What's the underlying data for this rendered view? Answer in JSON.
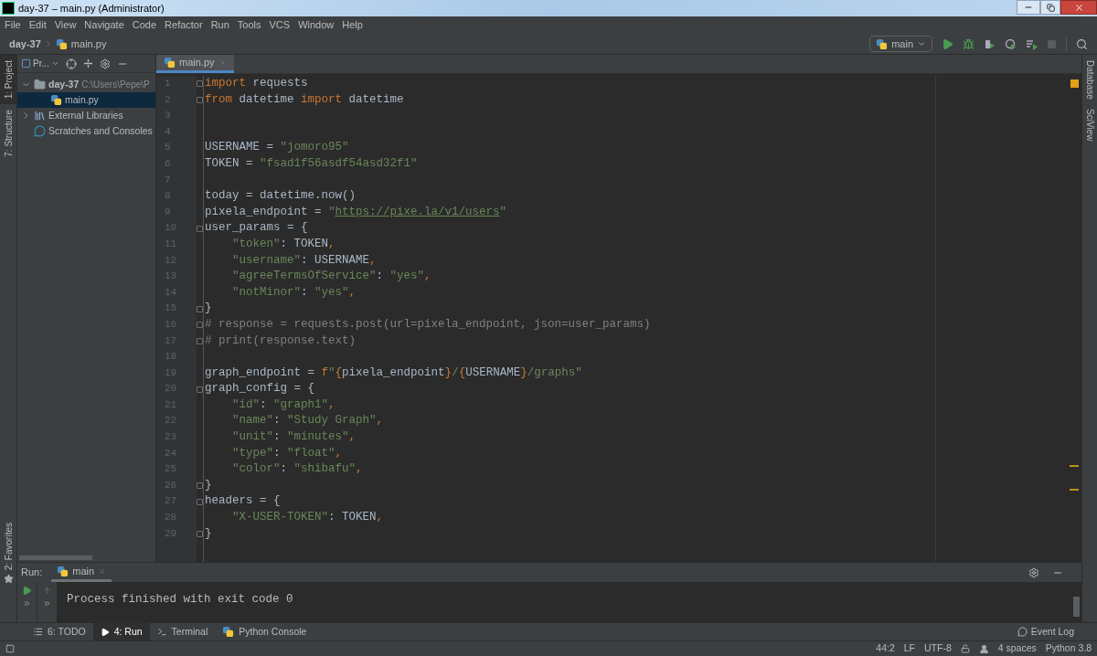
{
  "window": {
    "title": "day-37 – main.py (Administrator)"
  },
  "menu": [
    "File",
    "Edit",
    "View",
    "Navigate",
    "Code",
    "Refactor",
    "Run",
    "Tools",
    "VCS",
    "Window",
    "Help"
  ],
  "breadcrumb": [
    "day-37",
    "main.py"
  ],
  "run_config": {
    "label": "main"
  },
  "left_tool_tabs": [
    {
      "label": "1: Project",
      "selected": true
    },
    {
      "label": "7: Structure",
      "selected": false
    }
  ],
  "bottom_left_tool_tab": {
    "label": "2: Favorites"
  },
  "right_tool_tabs": [
    {
      "label": "Database"
    },
    {
      "label": "SciView"
    }
  ],
  "project": {
    "view_label": "Pr...",
    "tree": [
      {
        "label": "day-37",
        "kind": "folder",
        "path": "C:\\Users\\Pepe\\P",
        "expanded": true,
        "selected": false,
        "children": [
          {
            "label": "main.py",
            "kind": "python",
            "selected": true
          }
        ]
      },
      {
        "label": "External Libraries",
        "kind": "library",
        "expanded": false,
        "selected": false
      },
      {
        "label": "Scratches and Consoles",
        "kind": "scratch",
        "selected": false
      }
    ]
  },
  "editor": {
    "tabs": [
      {
        "label": "main.py",
        "selected": true
      }
    ],
    "lines": [
      {
        "number": "1",
        "fold": true,
        "tokens": [
          {
            "kind": "keyword",
            "text": "import"
          },
          {
            "kind": "plain",
            "text": " requests"
          }
        ]
      },
      {
        "number": "2",
        "fold": true,
        "tokens": [
          {
            "kind": "keyword",
            "text": "from"
          },
          {
            "kind": "plain",
            "text": " datetime "
          },
          {
            "kind": "keyword",
            "text": "import"
          },
          {
            "kind": "plain",
            "text": " datetime"
          }
        ]
      },
      {
        "number": "3",
        "fold": false
      },
      {
        "number": "4",
        "fold": false
      },
      {
        "number": "5",
        "fold": false,
        "tokens": [
          {
            "kind": "plain",
            "text": "USERNAME = "
          },
          {
            "kind": "string",
            "text": "\"jomoro95\""
          }
        ]
      },
      {
        "number": "6",
        "fold": false,
        "tokens": [
          {
            "kind": "plain",
            "text": "TOKEN = "
          },
          {
            "kind": "string",
            "text": "\"fsad1f56asdf54asd32f1\""
          }
        ]
      },
      {
        "number": "7",
        "fold": false
      },
      {
        "number": "8",
        "fold": false,
        "tokens": [
          {
            "kind": "plain",
            "text": "today = datetime.now()"
          }
        ]
      },
      {
        "number": "9",
        "fold": false,
        "tokens": [
          {
            "kind": "plain",
            "text": "pixela_endpoint = "
          },
          {
            "kind": "string",
            "text": "\""
          },
          {
            "kind": "link",
            "text": "https://pixe.la/v1/users"
          },
          {
            "kind": "string",
            "text": "\""
          }
        ]
      },
      {
        "number": "10",
        "fold": true,
        "tokens": [
          {
            "kind": "plain",
            "text": "user_params = {"
          }
        ]
      },
      {
        "number": "11",
        "fold": false,
        "indented": true,
        "tokens": [
          {
            "kind": "string",
            "text": "\"token\""
          },
          {
            "kind": "plain",
            "text": ": TOKEN"
          },
          {
            "kind": "punct",
            "text": ","
          }
        ]
      },
      {
        "number": "12",
        "fold": false,
        "indented": true,
        "tokens": [
          {
            "kind": "string",
            "text": "\"username\""
          },
          {
            "kind": "plain",
            "text": ": USERNAME"
          },
          {
            "kind": "punct",
            "text": ","
          }
        ]
      },
      {
        "number": "13",
        "fold": false,
        "indented": true,
        "tokens": [
          {
            "kind": "string",
            "text": "\"agreeTermsOfService\""
          },
          {
            "kind": "plain",
            "text": ": "
          },
          {
            "kind": "string",
            "text": "\"yes\""
          },
          {
            "kind": "punct",
            "text": ","
          }
        ]
      },
      {
        "number": "14",
        "fold": false,
        "indented": true,
        "tokens": [
          {
            "kind": "string",
            "text": "\"notMinor\""
          },
          {
            "kind": "plain",
            "text": ": "
          },
          {
            "kind": "string",
            "text": "\"yes\""
          },
          {
            "kind": "punct",
            "text": ","
          }
        ]
      },
      {
        "number": "15",
        "fold": true,
        "tokens": [
          {
            "kind": "plain",
            "text": "}"
          }
        ]
      },
      {
        "number": "16",
        "fold": true,
        "tokens": [
          {
            "kind": "comment",
            "text": "# response = requests.post(url=pixela_endpoint, json=user_params)"
          }
        ]
      },
      {
        "number": "17",
        "fold": true,
        "tokens": [
          {
            "kind": "comment",
            "text": "# print(response.text)"
          }
        ]
      },
      {
        "number": "18",
        "fold": false
      },
      {
        "number": "19",
        "fold": false,
        "tokens": [
          {
            "kind": "plain",
            "text": "graph_endpoint = "
          },
          {
            "kind": "keyword",
            "text": "f"
          },
          {
            "kind": "string",
            "text": "\""
          },
          {
            "kind": "punct",
            "text": "{"
          },
          {
            "kind": "plain",
            "text": "pixela_endpoint"
          },
          {
            "kind": "punct",
            "text": "}"
          },
          {
            "kind": "string",
            "text": "/"
          },
          {
            "kind": "punct",
            "text": "{"
          },
          {
            "kind": "plain",
            "text": "USERNAME"
          },
          {
            "kind": "punct",
            "text": "}"
          },
          {
            "kind": "string",
            "text": "/graphs\""
          }
        ]
      },
      {
        "number": "20",
        "fold": true,
        "tokens": [
          {
            "kind": "plain",
            "text": "graph_config = {"
          }
        ]
      },
      {
        "number": "21",
        "fold": false,
        "indented": true,
        "tokens": [
          {
            "kind": "string",
            "text": "\"id\""
          },
          {
            "kind": "plain",
            "text": ": "
          },
          {
            "kind": "string",
            "text": "\"graph1\""
          },
          {
            "kind": "punct",
            "text": ","
          }
        ]
      },
      {
        "number": "22",
        "fold": false,
        "indented": true,
        "tokens": [
          {
            "kind": "string",
            "text": "\"name\""
          },
          {
            "kind": "plain",
            "text": ": "
          },
          {
            "kind": "string",
            "text": "\"Study Graph\""
          },
          {
            "kind": "punct",
            "text": ","
          }
        ]
      },
      {
        "number": "23",
        "fold": false,
        "indented": true,
        "tokens": [
          {
            "kind": "string",
            "text": "\"unit\""
          },
          {
            "kind": "plain",
            "text": ": "
          },
          {
            "kind": "string",
            "text": "\"minutes\""
          },
          {
            "kind": "punct",
            "text": ","
          }
        ]
      },
      {
        "number": "24",
        "fold": false,
        "indented": true,
        "tokens": [
          {
            "kind": "string",
            "text": "\"type\""
          },
          {
            "kind": "plain",
            "text": ": "
          },
          {
            "kind": "string",
            "text": "\"float\""
          },
          {
            "kind": "punct",
            "text": ","
          }
        ]
      },
      {
        "number": "25",
        "fold": false,
        "indented": true,
        "tokens": [
          {
            "kind": "string",
            "text": "\"color\""
          },
          {
            "kind": "plain",
            "text": ": "
          },
          {
            "kind": "string",
            "text": "\"shibafu\""
          },
          {
            "kind": "punct",
            "text": ","
          }
        ]
      },
      {
        "number": "26",
        "fold": true,
        "tokens": [
          {
            "kind": "plain",
            "text": "}"
          }
        ]
      },
      {
        "number": "27",
        "fold": true,
        "tokens": [
          {
            "kind": "plain",
            "text": "headers = {"
          }
        ]
      },
      {
        "number": "28",
        "fold": false,
        "indented": true,
        "tokens": [
          {
            "kind": "string",
            "text": "\"X-USER-TOKEN\""
          },
          {
            "kind": "plain",
            "text": ": TOKEN"
          },
          {
            "kind": "punct",
            "text": ","
          }
        ]
      },
      {
        "number": "29",
        "fold": true,
        "tokens": [
          {
            "kind": "plain",
            "text": "}"
          }
        ]
      }
    ]
  },
  "run_panel": {
    "label": "Run:",
    "tab": "main",
    "output": "Process finished with exit code 0"
  },
  "bottom_tabs": [
    {
      "label": "6: TODO",
      "kind": "todo",
      "selected": false
    },
    {
      "label": "4: Run",
      "kind": "run",
      "selected": true
    },
    {
      "label": "Terminal",
      "kind": "terminal",
      "selected": false
    },
    {
      "label": "Python Console",
      "kind": "python",
      "selected": false
    }
  ],
  "event_log": "Event Log",
  "status_bar": {
    "position": "44:2",
    "line_separator": "LF",
    "encoding": "UTF-8",
    "indent": "4 spaces",
    "interpreter": "Python 3.8"
  }
}
